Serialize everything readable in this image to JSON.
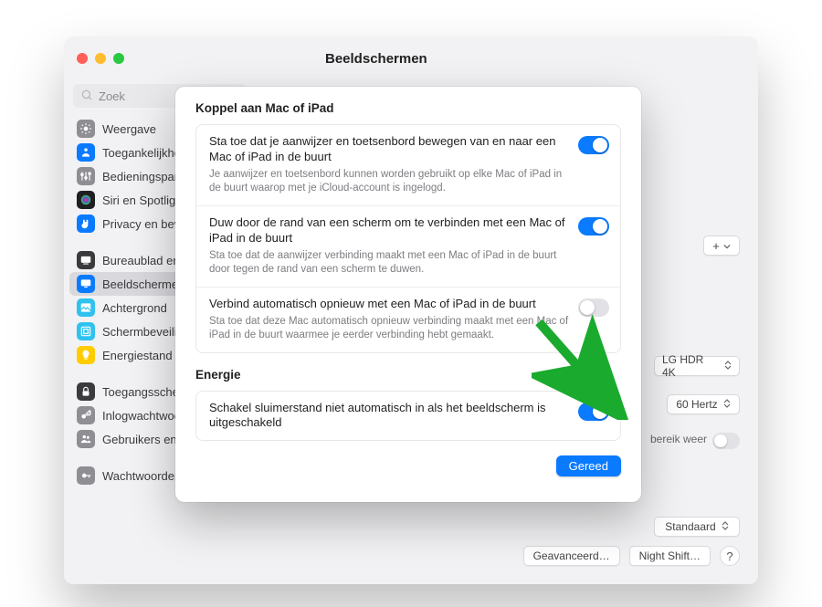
{
  "window": {
    "title": "Beeldschermen"
  },
  "search": {
    "placeholder": "Zoek"
  },
  "sidebar": {
    "items": [
      {
        "label": "Weergave",
        "icon": "sun",
        "bg": "#8e8e93"
      },
      {
        "label": "Toegankelijkheid",
        "icon": "person",
        "bg": "#0a7aff"
      },
      {
        "label": "Bedieningspaneel",
        "icon": "sliders",
        "bg": "#8e8e93"
      },
      {
        "label": "Siri en Spotlight",
        "icon": "siri",
        "bg": "#1f1f21"
      },
      {
        "label": "Privacy en beveiliging",
        "icon": "hand",
        "bg": "#0a7aff"
      },
      {
        "gap": true
      },
      {
        "label": "Bureaublad en Dock",
        "icon": "dock",
        "bg": "#3b3b3d"
      },
      {
        "label": "Beeldschermen",
        "icon": "display",
        "bg": "#0a7aff",
        "selected": true
      },
      {
        "label": "Achtergrond",
        "icon": "picture",
        "bg": "#2fc2ef"
      },
      {
        "label": "Schermbeveiliging",
        "icon": "frame",
        "bg": "#2fc2ef"
      },
      {
        "label": "Energiestand",
        "icon": "bulb",
        "bg": "#ffcc00"
      },
      {
        "gap": true
      },
      {
        "label": "Toegangsscherm",
        "icon": "lock",
        "bg": "#3b3b3d"
      },
      {
        "label": "Inlogwachtwoord",
        "icon": "key",
        "bg": "#8e8e93"
      },
      {
        "label": "Gebruikers en groepen",
        "icon": "users",
        "bg": "#8e8e93"
      },
      {
        "gap": true
      },
      {
        "label": "Wachtwoorden",
        "icon": "keyround",
        "bg": "#8e8e93"
      }
    ]
  },
  "bgControls": {
    "addButton": "+",
    "displaySelect": "LG HDR 4K",
    "refreshSelect": "60 Hertz",
    "hdrLabel": "bereik weer",
    "presetSelect": "Standaard",
    "advancedButton": "Geavanceerd…",
    "nightShiftButton": "Night Shift…"
  },
  "modal": {
    "section1": "Koppel aan Mac of iPad",
    "rows1": [
      {
        "title": "Sta toe dat je aanwijzer en toetsenbord bewegen van en naar een Mac of iPad in de buurt",
        "desc": "Je aanwijzer en toetsenbord kunnen worden gebruikt op elke Mac of iPad in de buurt waarop met je iCloud-account is ingelogd.",
        "on": true
      },
      {
        "title": "Duw door de rand van een scherm om te verbinden met een Mac of iPad in de buurt",
        "desc": "Sta toe dat de aanwijzer verbinding maakt met een Mac of iPad in de buurt door tegen de rand van een scherm te duwen.",
        "on": true
      },
      {
        "title": "Verbind automatisch opnieuw met een Mac of iPad in de buurt",
        "desc": "Sta toe dat deze Mac automatisch opnieuw verbinding maakt met een Mac of iPad in de buurt waarmee je eerder verbinding hebt gemaakt.",
        "on": false
      }
    ],
    "section2": "Energie",
    "rows2": [
      {
        "title": "Schakel sluimerstand niet automatisch in als het beeldscherm is uitgeschakeld",
        "on": true
      }
    ],
    "doneLabel": "Gereed"
  }
}
